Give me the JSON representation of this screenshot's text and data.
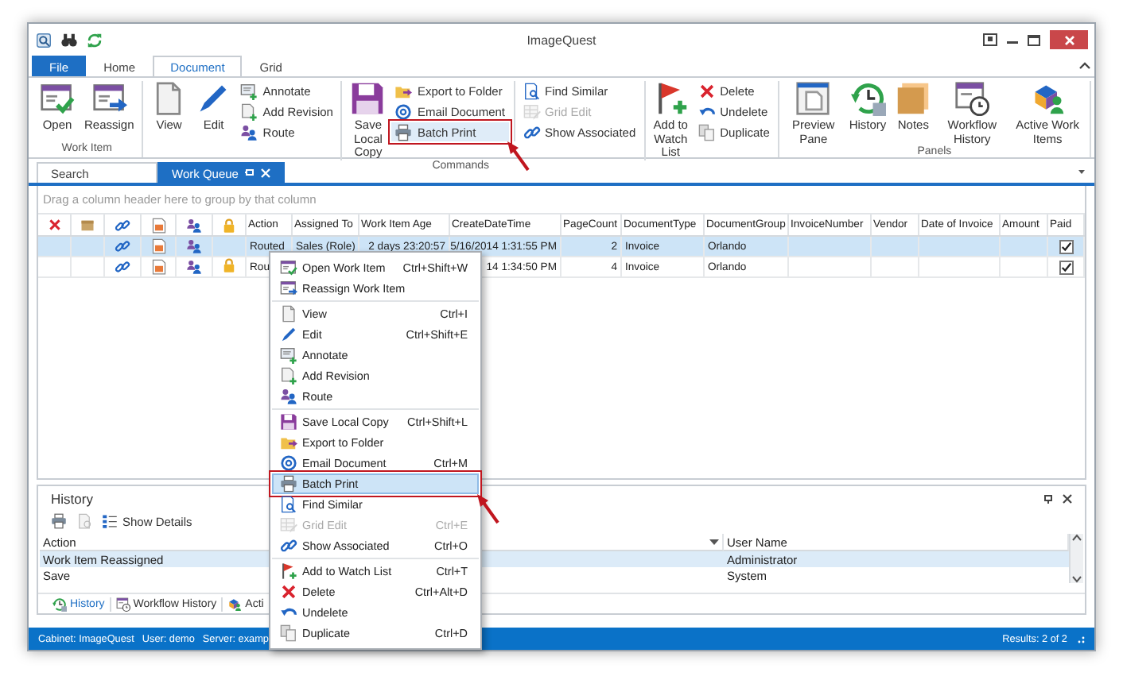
{
  "window": {
    "title": "ImageQuest"
  },
  "ribbon_tabs": [
    {
      "label": "File",
      "kind": "file",
      "selected": false
    },
    {
      "label": "Home",
      "kind": "tab",
      "selected": false
    },
    {
      "label": "Document",
      "kind": "tab",
      "selected": true
    },
    {
      "label": "Grid",
      "kind": "tab",
      "selected": false
    }
  ],
  "ribbon_groups": [
    {
      "label": "Work Item",
      "sections": [
        [
          {
            "kind": "large",
            "label": "Open"
          },
          {
            "kind": "large",
            "label": "Reassign"
          }
        ]
      ]
    },
    {
      "label": "Commands",
      "sections": [
        [
          {
            "kind": "large",
            "label": "View"
          },
          {
            "kind": "large",
            "label": "Edit"
          },
          {
            "kind": "stack",
            "items": [
              {
                "label": "Annotate",
                "disabled": false,
                "callout": false
              },
              {
                "label": "Add Revision",
                "disabled": false,
                "callout": false
              },
              {
                "label": "Route",
                "disabled": false,
                "callout": false
              }
            ]
          }
        ],
        [
          {
            "kind": "large",
            "label": "Save Local Copy"
          },
          {
            "kind": "stack",
            "items": [
              {
                "label": "Export to Folder",
                "disabled": false,
                "callout": false
              },
              {
                "label": "Email Document",
                "disabled": false,
                "callout": false
              },
              {
                "label": "Batch Print",
                "disabled": false,
                "callout": true
              }
            ]
          }
        ],
        [
          {
            "kind": "stack",
            "items": [
              {
                "label": "Find Similar",
                "disabled": false,
                "callout": false
              },
              {
                "label": "Grid Edit",
                "disabled": true,
                "callout": false
              },
              {
                "label": "Show Associated",
                "disabled": false,
                "callout": false
              }
            ]
          }
        ],
        [
          {
            "kind": "large",
            "label": "Add to Watch List"
          },
          {
            "kind": "stack",
            "items": [
              {
                "label": "Delete",
                "disabled": false,
                "callout": false
              },
              {
                "label": "Undelete",
                "disabled": false,
                "callout": false
              },
              {
                "label": "Duplicate",
                "disabled": false,
                "callout": false
              }
            ]
          }
        ]
      ]
    },
    {
      "label": "Panels",
      "sections": [
        [
          {
            "kind": "large",
            "label": "Preview Pane"
          },
          {
            "kind": "large",
            "label": "History"
          },
          {
            "kind": "large",
            "label": "Notes"
          },
          {
            "kind": "large",
            "label": "Workflow History"
          },
          {
            "kind": "large",
            "label": "Active Work Items"
          }
        ]
      ]
    }
  ],
  "document_tabs": [
    {
      "label": "Search",
      "selected": false,
      "closable": false
    },
    {
      "label": "Work Queue",
      "selected": true,
      "closable": true
    }
  ],
  "grid": {
    "group_panel_hint": "Drag a column header here to group by that column",
    "columns": [
      "Action",
      "Assigned To",
      "Work Item Age",
      "CreateDateTime",
      "PageCount",
      "DocumentType",
      "DocumentGroup",
      "InvoiceNumber",
      "Vendor",
      "Date of Invoice",
      "Amount",
      "Paid"
    ],
    "rows": [
      {
        "selected": true,
        "locked": false,
        "paid": true,
        "cells": [
          "Routed",
          "Sales (Role)",
          "2 days 23:20:57",
          "5/16/2014 1:31:55 PM",
          "2",
          "Invoice",
          "Orlando"
        ]
      },
      {
        "selected": false,
        "locked": true,
        "paid": true,
        "cells": [
          "Rou",
          null,
          null,
          "14 1:34:50 PM",
          "4",
          "Invoice",
          "Orlando"
        ]
      }
    ]
  },
  "history": {
    "title": "History",
    "toolbar_button": "Show Details",
    "columns": [
      "Action",
      "User Name"
    ],
    "rows": [
      {
        "selected": true,
        "cells": [
          "Work Item Reassigned",
          "Administrator"
        ]
      },
      {
        "selected": false,
        "cells": [
          "Save",
          "System"
        ]
      }
    ],
    "tabs": [
      {
        "label": "History",
        "selected": true
      },
      {
        "label": "Workflow History",
        "selected": false
      },
      {
        "label": "Acti",
        "selected": false
      }
    ]
  },
  "context_menu": {
    "groups": [
      [
        {
          "label": "Open Work Item",
          "shortcut": "Ctrl+Shift+W",
          "disabled": false,
          "selected": false,
          "callout": false
        },
        {
          "label": "Reassign Work Item",
          "disabled": false,
          "selected": false,
          "callout": false
        }
      ],
      [
        {
          "label": "View",
          "shortcut": "Ctrl+I",
          "disabled": false,
          "selected": false,
          "callout": false
        },
        {
          "label": "Edit",
          "shortcut": "Ctrl+Shift+E",
          "disabled": false,
          "selected": false,
          "callout": false
        },
        {
          "label": "Annotate",
          "disabled": false,
          "selected": false,
          "callout": false
        },
        {
          "label": "Add Revision",
          "disabled": false,
          "selected": false,
          "callout": false
        },
        {
          "label": "Route",
          "disabled": false,
          "selected": false,
          "callout": false
        }
      ],
      [
        {
          "label": "Save Local Copy",
          "shortcut": "Ctrl+Shift+L",
          "disabled": false,
          "selected": false,
          "callout": false
        },
        {
          "label": "Export to Folder",
          "disabled": false,
          "selected": false,
          "callout": false
        },
        {
          "label": "Email Document",
          "shortcut": "Ctrl+M",
          "disabled": false,
          "selected": false,
          "callout": false
        },
        {
          "label": "Batch Print",
          "disabled": false,
          "selected": true,
          "callout": true
        },
        {
          "label": "Find Similar",
          "disabled": false,
          "selected": false,
          "callout": false
        },
        {
          "label": "Grid Edit",
          "shortcut": "Ctrl+E",
          "disabled": true,
          "selected": false,
          "callout": false
        },
        {
          "label": "Show Associated",
          "shortcut": "Ctrl+O",
          "disabled": false,
          "selected": false,
          "callout": false
        }
      ],
      [
        {
          "label": "Add to Watch List",
          "shortcut": "Ctrl+T",
          "disabled": false,
          "selected": false,
          "callout": false
        },
        {
          "label": "Delete",
          "shortcut": "Ctrl+Alt+D",
          "disabled": false,
          "selected": false,
          "callout": false
        },
        {
          "label": "Undelete",
          "disabled": false,
          "selected": false,
          "callout": false
        },
        {
          "label": "Duplicate",
          "shortcut": "Ctrl+D",
          "disabled": false,
          "selected": false,
          "callout": false
        }
      ]
    ]
  },
  "status_bar": {
    "items": [
      "Cabinet: ImageQuest",
      "User: demo",
      "Server: examp"
    ],
    "results": "Results: 2 of 2"
  }
}
